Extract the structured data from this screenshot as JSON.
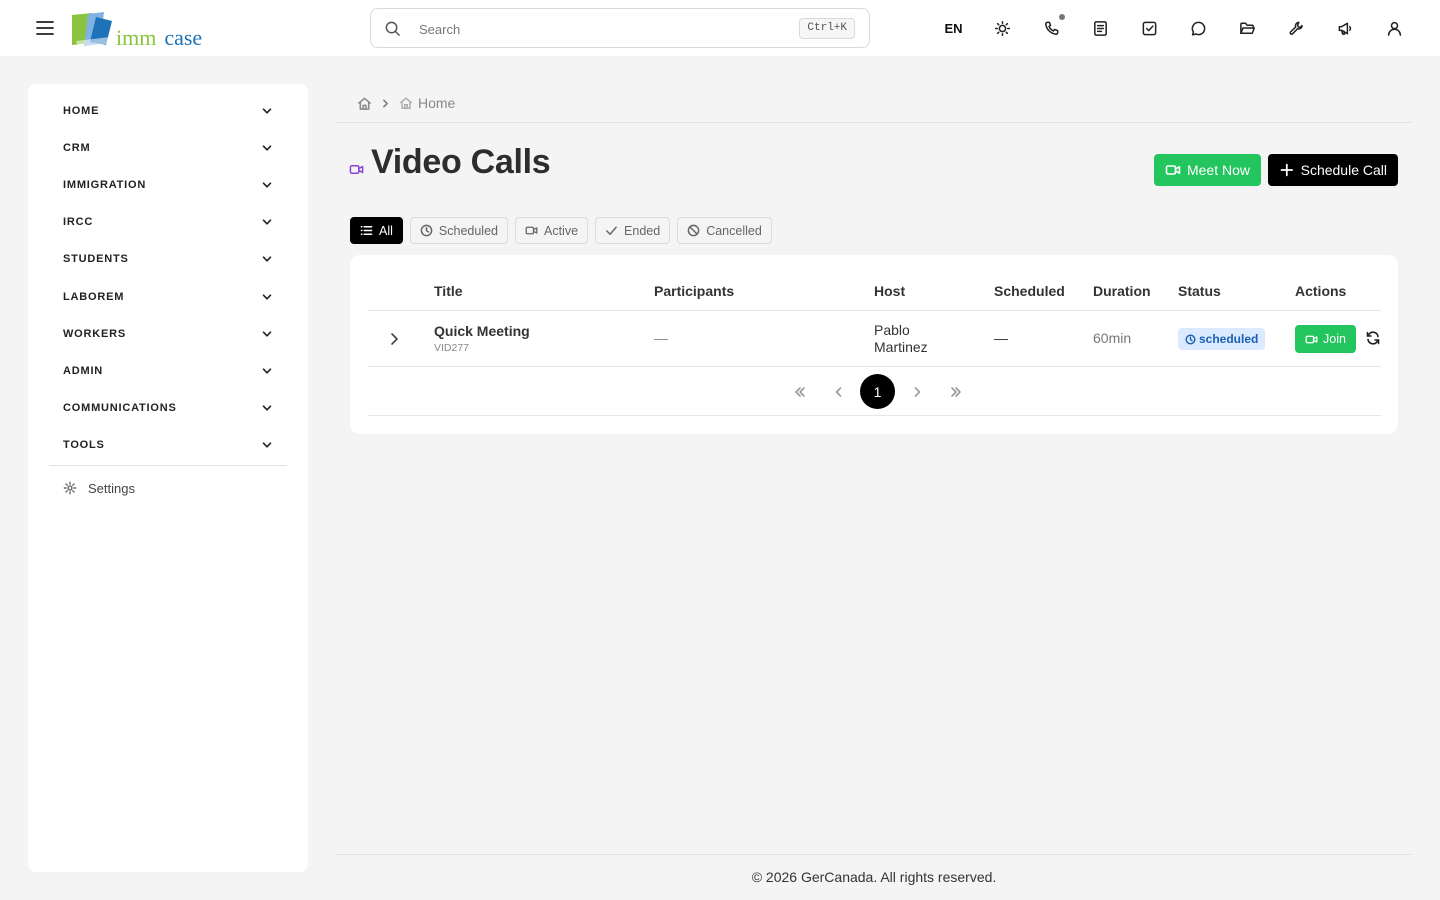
{
  "app": {
    "logo_text_1": "imm",
    "logo_text_2": "case",
    "logo_colors": {
      "green": "#8ac43f",
      "blue": "#1d72b8"
    }
  },
  "header": {
    "search_placeholder": "Search",
    "search_value": "",
    "shortcut": "Ctrl+K",
    "language": "EN",
    "icons": [
      "menu-icon",
      "theme-sun-icon",
      "phone-icon",
      "notes-icon",
      "tasks-check-icon",
      "messages-icon",
      "folder-icon",
      "tools-wrench-icon",
      "announcements-megaphone-icon",
      "user-icon"
    ]
  },
  "sidebar": {
    "items": [
      {
        "label": "HOME"
      },
      {
        "label": "CRM"
      },
      {
        "label": "IMMIGRATION"
      },
      {
        "label": "IRCC"
      },
      {
        "label": "STUDENTS"
      },
      {
        "label": "LABOREM"
      },
      {
        "label": "WORKERS"
      },
      {
        "label": "ADMIN"
      },
      {
        "label": "COMMUNICATIONS"
      },
      {
        "label": "TOOLS"
      }
    ],
    "settings_label": "Settings"
  },
  "breadcrumb": {
    "current": "Home"
  },
  "page": {
    "title": "Video Calls",
    "title_icon_color": "#8b45d6",
    "meet_now_label": "Meet Now",
    "schedule_call_label": "Schedule Call"
  },
  "filters": [
    {
      "label": "All",
      "active": true
    },
    {
      "label": "Scheduled",
      "active": false
    },
    {
      "label": "Active",
      "active": false
    },
    {
      "label": "Ended",
      "active": false
    },
    {
      "label": "Cancelled",
      "active": false
    }
  ],
  "table": {
    "columns": [
      "Title",
      "Participants",
      "Host",
      "Scheduled",
      "Duration",
      "Status",
      "Actions"
    ],
    "rows": [
      {
        "title": "Quick Meeting",
        "id": "VID277",
        "participants": "—",
        "host": "Pablo Martinez",
        "scheduled": "—",
        "duration": "60min",
        "status": "scheduled",
        "action_label": "Join"
      }
    ]
  },
  "pagination": {
    "current_page": "1"
  },
  "colors": {
    "primary_green": "#22c55e",
    "status_bg": "#dbeafe",
    "status_text": "#1a5fb4"
  },
  "footer": {
    "copyright": "© 2026 GerCanada. All rights reserved."
  }
}
